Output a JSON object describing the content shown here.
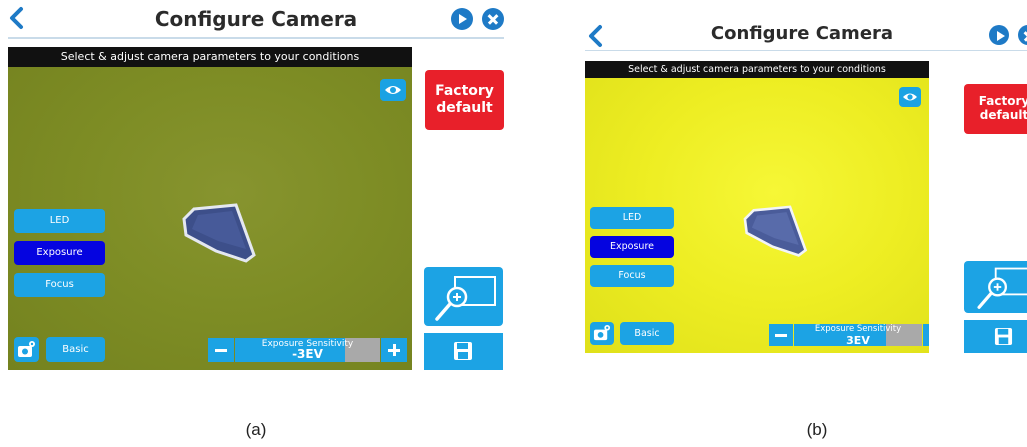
{
  "panels": {
    "a": {
      "header": {
        "title": "Configure Camera"
      },
      "instruction": "Select & adjust camera parameters to your conditions",
      "modes": {
        "led": "LED",
        "exposure": "Exposure",
        "focus": "Focus"
      },
      "basic_label": "Basic",
      "exposure": {
        "label": "Exposure Sensitivity",
        "value": "-3EV",
        "level": 0.76
      },
      "factory_default": {
        "line1": "Factory",
        "line2": "default"
      },
      "feed_color": "#7e8d25",
      "caption": "(a)"
    },
    "b": {
      "header": {
        "title": "Configure Camera"
      },
      "instruction": "Select & adjust camera parameters to your conditions",
      "modes": {
        "led": "LED",
        "exposure": "Exposure",
        "focus": "Focus"
      },
      "basic_label": "Basic",
      "exposure": {
        "label": "Exposure Sensitivity",
        "value": "3EV",
        "level": 0.72
      },
      "factory_default": {
        "line1": "Factory",
        "line2": "default"
      },
      "feed_color": "#eded22",
      "caption": "(b)"
    }
  },
  "colors": {
    "accent": "#1ca3e4",
    "active_mode": "#0504e0",
    "factory_red": "#e8202a",
    "header_icon": "#1e7ac6"
  },
  "icons": [
    "back-arrow-icon",
    "next-icon",
    "close-icon",
    "eye-icon",
    "camera-settings-icon",
    "zoom-in-icon",
    "save-icon",
    "minus-icon",
    "plus-icon"
  ]
}
